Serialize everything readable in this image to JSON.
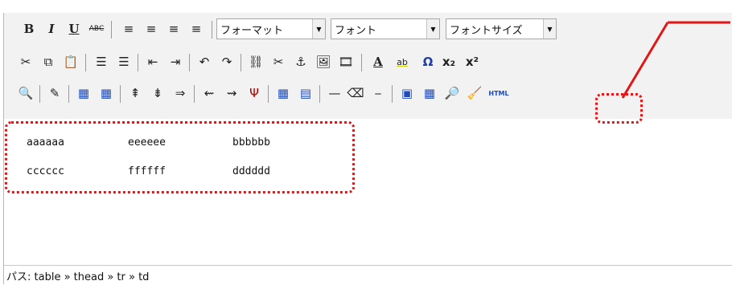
{
  "toolbar": {
    "row1": [
      {
        "type": "button",
        "name": "bold-button",
        "label": "B"
      },
      {
        "type": "button",
        "name": "italic-button",
        "label": "I"
      },
      {
        "type": "button",
        "name": "underline-button",
        "label": "U"
      },
      {
        "type": "button",
        "name": "strikethrough-button",
        "label": "ABC"
      },
      {
        "type": "button",
        "name": "align-left-button",
        "label": "≡"
      },
      {
        "type": "button",
        "name": "align-center-button",
        "label": "≡"
      },
      {
        "type": "button",
        "name": "align-right-button",
        "label": "≡"
      },
      {
        "type": "button",
        "name": "align-justify-button",
        "label": "≡"
      },
      {
        "type": "select",
        "name": "format-select",
        "label": "フォーマット"
      },
      {
        "type": "select",
        "name": "font-select",
        "label": "フォント"
      },
      {
        "type": "select",
        "name": "font-size-select",
        "label": "フォントサイズ"
      }
    ],
    "row2": [
      {
        "type": "button",
        "name": "cut-button",
        "label": "✂"
      },
      {
        "type": "button",
        "name": "copy-button",
        "label": "⧉"
      },
      {
        "type": "button",
        "name": "paste-button",
        "label": "📋"
      },
      {
        "type": "button",
        "name": "unordered-list-button",
        "label": "☰"
      },
      {
        "type": "button",
        "name": "ordered-list-button",
        "label": "☰"
      },
      {
        "type": "button",
        "name": "outdent-button",
        "label": "⇤"
      },
      {
        "type": "button",
        "name": "indent-button",
        "label": "⇥"
      },
      {
        "type": "button",
        "name": "undo-button",
        "label": "↶"
      },
      {
        "type": "button",
        "name": "redo-button",
        "label": "↷"
      },
      {
        "type": "button",
        "name": "link-button",
        "label": "⛓"
      },
      {
        "type": "button",
        "name": "unlink-button",
        "label": "✂"
      },
      {
        "type": "button",
        "name": "anchor-button",
        "label": "⚓"
      },
      {
        "type": "button",
        "name": "image-button",
        "label": "🖼"
      },
      {
        "type": "button",
        "name": "media-button",
        "label": "🎞"
      },
      {
        "type": "button",
        "name": "text-color-button",
        "label": "A"
      },
      {
        "type": "button",
        "name": "highlight-color-button",
        "label": "ab"
      },
      {
        "type": "button",
        "name": "special-char-button",
        "label": "Ω"
      },
      {
        "type": "button",
        "name": "subscript-button",
        "label": "x₂"
      },
      {
        "type": "button",
        "name": "superscript-button",
        "label": "x²"
      }
    ],
    "row3": [
      {
        "type": "button",
        "name": "find-button",
        "label": "🔍"
      },
      {
        "type": "button",
        "name": "edit-button",
        "label": "✎"
      },
      {
        "type": "button",
        "name": "table-button",
        "label": "▦"
      },
      {
        "type": "button",
        "name": "table-props-button",
        "label": "▦"
      },
      {
        "type": "button",
        "name": "insert-row-before-button",
        "label": "⇞"
      },
      {
        "type": "button",
        "name": "insert-row-after-button",
        "label": "⇟"
      },
      {
        "type": "button",
        "name": "delete-row-button",
        "label": "⇒"
      },
      {
        "type": "button",
        "name": "insert-col-before-button",
        "label": "⇜"
      },
      {
        "type": "button",
        "name": "insert-col-after-button",
        "label": "⇝"
      },
      {
        "type": "button",
        "name": "delete-col-button",
        "label": "Ψ"
      },
      {
        "type": "button",
        "name": "cell-props-button",
        "label": "▦"
      },
      {
        "type": "button",
        "name": "merge-cells-button",
        "label": "▤"
      },
      {
        "type": "button",
        "name": "horizontal-rule-button",
        "label": "—"
      },
      {
        "type": "button",
        "name": "remove-format-button",
        "label": "⌫"
      },
      {
        "type": "button",
        "name": "page-break-button",
        "label": "⎯"
      },
      {
        "type": "button",
        "name": "visual-aid-button",
        "label": "▣"
      },
      {
        "type": "button",
        "name": "table-grid-button",
        "label": "▦"
      },
      {
        "type": "button",
        "name": "preview-button",
        "label": "🔎"
      },
      {
        "type": "button",
        "name": "cleanup-button",
        "label": "🧹"
      },
      {
        "type": "button",
        "name": "html-button",
        "label": "HTML"
      }
    ]
  },
  "content": {
    "rows": [
      [
        "aaaaaa",
        "eeeeee",
        "bbbbbb"
      ],
      [
        "cccccc",
        "ffffff",
        "dddddd"
      ]
    ]
  },
  "status": {
    "path_label": "パス:",
    "path_parts": [
      "table",
      "thead",
      "tr",
      "td"
    ],
    "path_text": "パス: table » thead » tr » td"
  },
  "colors": {
    "annotation": "#e11616"
  }
}
